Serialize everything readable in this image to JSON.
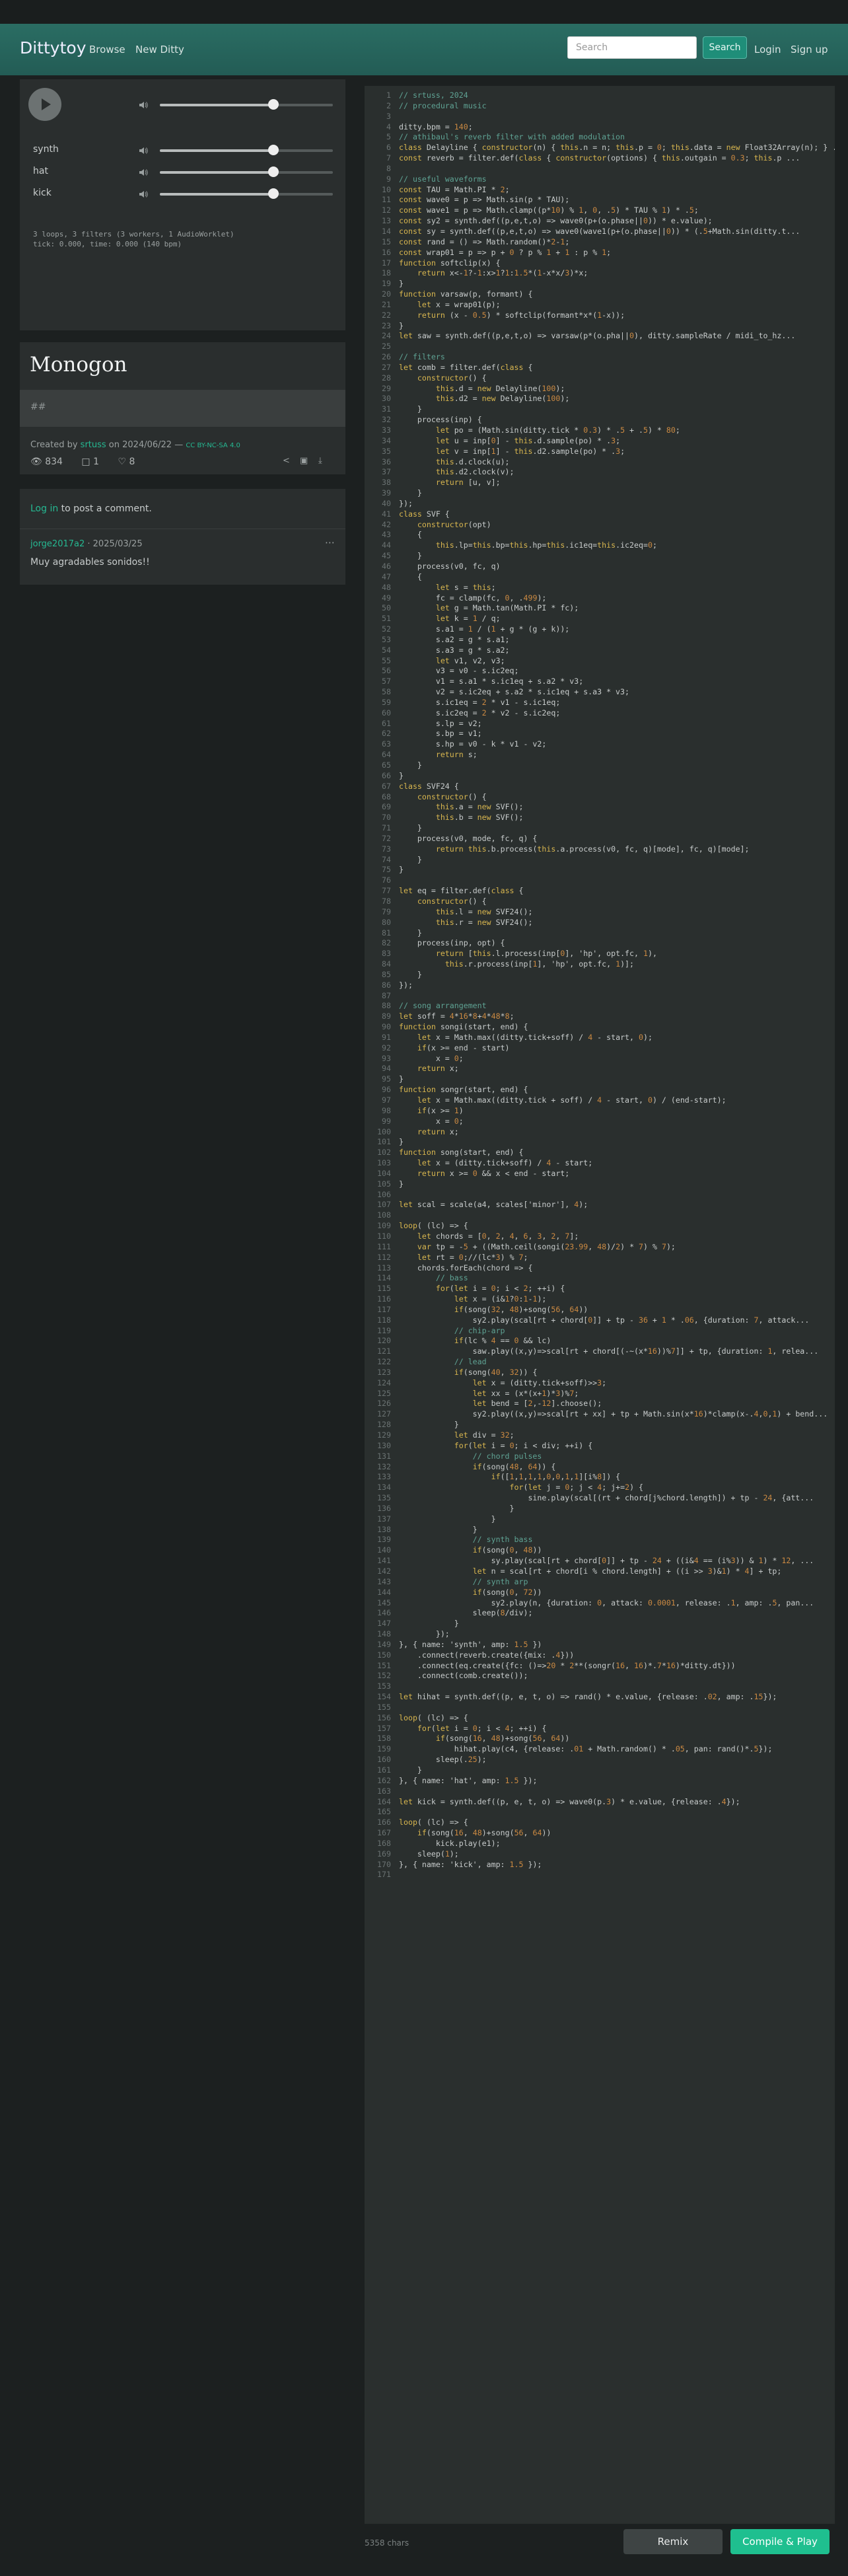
{
  "nav": {
    "brand": "Dittytoy",
    "browse": "Browse",
    "new_ditty": "New Ditty",
    "search_placeholder": "Search",
    "search_button": "Search",
    "login": "Login",
    "signup": "Sign up"
  },
  "player": {
    "tracks": [
      {
        "label": "synth",
        "volume": 0.66
      },
      {
        "label": "hat",
        "volume": 0.66
      },
      {
        "label": "kick",
        "volume": 0.66
      }
    ],
    "master_volume": 0.66,
    "status1": "3 loops, 3 filters (3 workers, 1 AudioWorklet)",
    "status2": "tick: 0.000, time: 0.000 (140 bpm)"
  },
  "ditty": {
    "title": "Monogon",
    "description": "##",
    "created_prefix": "Created by ",
    "author": "srtuss",
    "date_prefix": " on 2024/06/22 — ",
    "license": "CC BY-NC-SA 4.0",
    "views": "834",
    "comments": "1",
    "likes": "8"
  },
  "comments": {
    "login_link": "Log in",
    "login_text": " to post a comment.",
    "items": [
      {
        "author": "jorge2017a2",
        "date": " · 2025/03/25",
        "text": "Muy agradables sonidos!!"
      }
    ]
  },
  "editor": {
    "chars": "5358 chars",
    "remix": "Remix",
    "compile": "Compile & Play"
  },
  "code_lines": [
    "// srtuss, 2024",
    "// procedural music",
    "",
    "ditty.bpm = 140;",
    "// athibaul's reverb filter with added modulation",
    "class Delayline { constructor(n) { this.n = n; this.p = 0; this.data = new Float32Array(n); } ...",
    "const reverb = filter.def(class { constructor(options) { this.outgain = 0.3; this.p ...",
    "",
    "// useful waveforms",
    "const TAU = Math.PI * 2;",
    "const wave0 = p => Math.sin(p * TAU);",
    "const wave1 = p => Math.clamp((p*10) % 1, 0, .5) * TAU % 1) * .5;",
    "const sy2 = synth.def((p,e,t,o) => wave0(p+(o.phase||0)) * e.value);",
    "const sy = synth.def((p,e,t,o) => wave0(wave1(p+(o.phase||0)) * (.5+Math.sin(ditty.t...",
    "const rand = () => Math.random()*2-1;",
    "const wrap01 = p => p + 0 ? p % 1 + 1 : p % 1;",
    "function softclip(x) {",
    "    return x<-1?-1:x>1?1:1.5*(1-x*x/3)*x;",
    "}",
    "function varsaw(p, formant) {",
    "    let x = wrap01(p);",
    "    return (x - 0.5) * softclip(formant*x*(1-x));",
    "}",
    "let saw = synth.def((p,e,t,o) => varsaw(p*(o.pha||0), ditty.sampleRate / midi_to_hz...",
    "",
    "// filters",
    "let comb = filter.def(class {",
    "    constructor() {",
    "        this.d = new Delayline(100);",
    "        this.d2 = new Delayline(100);",
    "    }",
    "    process(inp) {",
    "        let po = (Math.sin(ditty.tick * 0.3) * .5 + .5) * 80;",
    "        let u = inp[0] - this.d.sample(po) * .3;",
    "        let v = inp[1] - this.d2.sample(po) * .3;",
    "        this.d.clock(u);",
    "        this.d2.clock(v);",
    "        return [u, v];",
    "    }",
    "});",
    "class SVF {",
    "    constructor(opt)",
    "    {",
    "        this.lp=this.bp=this.hp=this.ic1eq=this.ic2eq=0;",
    "    }",
    "    process(v0, fc, q)",
    "    {",
    "        let s = this;",
    "        fc = clamp(fc, 0, .499);",
    "        let g = Math.tan(Math.PI * fc);",
    "        let k = 1 / q;",
    "        s.a1 = 1 / (1 + g * (g + k));",
    "        s.a2 = g * s.a1;",
    "        s.a3 = g * s.a2;",
    "        let v1, v2, v3;",
    "        v3 = v0 - s.ic2eq;",
    "        v1 = s.a1 * s.ic1eq + s.a2 * v3;",
    "        v2 = s.ic2eq + s.a2 * s.ic1eq + s.a3 * v3;",
    "        s.ic1eq = 2 * v1 - s.ic1eq;",
    "        s.ic2eq = 2 * v2 - s.ic2eq;",
    "        s.lp = v2;",
    "        s.bp = v1;",
    "        s.hp = v0 - k * v1 - v2;",
    "        return s;",
    "    }",
    "}",
    "class SVF24 {",
    "    constructor() {",
    "        this.a = new SVF();",
    "        this.b = new SVF();",
    "    }",
    "    process(v0, mode, fc, q) {",
    "        return this.b.process(this.a.process(v0, fc, q)[mode], fc, q)[mode];",
    "    }",
    "}",
    "",
    "let eq = filter.def(class {",
    "    constructor() {",
    "        this.l = new SVF24();",
    "        this.r = new SVF24();",
    "    }",
    "    process(inp, opt) {",
    "        return [this.l.process(inp[0], 'hp', opt.fc, 1),",
    "          this.r.process(inp[1], 'hp', opt.fc, 1)];",
    "    }",
    "});",
    "",
    "// song arrangement",
    "let soff = 4*16*8+4*48*8;",
    "function songi(start, end) {",
    "    let x = Math.max((ditty.tick+soff) / 4 - start, 0);",
    "    if(x >= end - start)",
    "        x = 0;",
    "    return x;",
    "}",
    "function songr(start, end) {",
    "    let x = Math.max((ditty.tick + soff) / 4 - start, 0) / (end-start);",
    "    if(x >= 1)",
    "        x = 0;",
    "    return x;",
    "}",
    "function song(start, end) {",
    "    let x = (ditty.tick+soff) / 4 - start;",
    "    return x >= 0 && x < end - start;",
    "}",
    "",
    "let scal = scale(a4, scales['minor'], 4);",
    "",
    "loop( (lc) => {",
    "    let chords = [0, 2, 4, 6, 3, 2, 7];",
    "    var tp = -5 + ((Math.ceil(songi(23.99, 48)/2) * 7) % 7);",
    "    let rt = 0;//(lc*3) % 7;",
    "    chords.forEach(chord => {",
    "        // bass",
    "        for(let i = 0; i < 2; ++i) {",
    "            let x = (i&1?0:1-1);",
    "            if(song(32, 48)+song(56, 64))",
    "                sy2.play(scal[rt + chord[0]] + tp - 36 + 1 * .06, {duration: 7, attack...",
    "            // chip-arp",
    "            if(lc % 4 == 0 && lc)",
    "                saw.play((x,y)=>scal[rt + chord[(-~(x*16))%7]] + tp, {duration: 1, relea...",
    "            // lead",
    "            if(song(40, 32)) {",
    "                let x = (ditty.tick+soff)>>3;",
    "                let xx = (x*(x+1)*3)%7;",
    "                let bend = [2,-12].choose();",
    "                sy2.play((x,y)=>scal[rt + xx] + tp + Math.sin(x*16)*clamp(x-.4,0,1) + bend...",
    "            }",
    "            let div = 32;",
    "            for(let i = 0; i < div; ++i) {",
    "                // chord pulses",
    "                if(song(48, 64)) {",
    "                    if([1,1,1,1,0,0,1,1][i%8]) {",
    "                        for(let j = 0; j < 4; j+=2) {",
    "                            sine.play(scal[(rt + chord[j%chord.length]) + tp - 24, {att...",
    "                        }",
    "                    }",
    "                }",
    "                // synth bass",
    "                if(song(0, 48))",
    "                    sy.play(scal[rt + chord[0]] + tp - 24 + ((i&4 == (i%3)) & 1) * 12, ...",
    "                let n = scal[rt + chord[i % chord.length] + ((i >> 3)&1) * 4] + tp;",
    "                // synth arp",
    "                if(song(0, 72))",
    "                    sy2.play(n, {duration: 0, attack: 0.0001, release: .1, amp: .5, pan...",
    "                sleep(8/div);",
    "            }",
    "        });",
    "}, { name: 'synth', amp: 1.5 })",
    "    .connect(reverb.create({mix: .4}))",
    "    .connect(eq.create({fc: ()=>20 * 2**(songr(16, 16)*.7*16)*ditty.dt}))",
    "    .connect(comb.create());",
    "",
    "let hihat = synth.def((p, e, t, o) => rand() * e.value, {release: .02, amp: .15});",
    "",
    "loop( (lc) => {",
    "    for(let i = 0; i < 4; ++i) {",
    "        if(song(16, 48)+song(56, 64))",
    "            hihat.play(c4, {release: .01 + Math.random() * .05, pan: rand()*.5});",
    "        sleep(.25);",
    "    }",
    "}, { name: 'hat', amp: 1.5 });",
    "",
    "let kick = synth.def((p, e, t, o) => wave0(p.3) * e.value, {release: .4});",
    "",
    "loop( (lc) => {",
    "    if(song(16, 48)+song(56, 64))",
    "        kick.play(e1);",
    "    sleep(1);",
    "}, { name: 'kick', amp: 1.5 });",
    ""
  ]
}
